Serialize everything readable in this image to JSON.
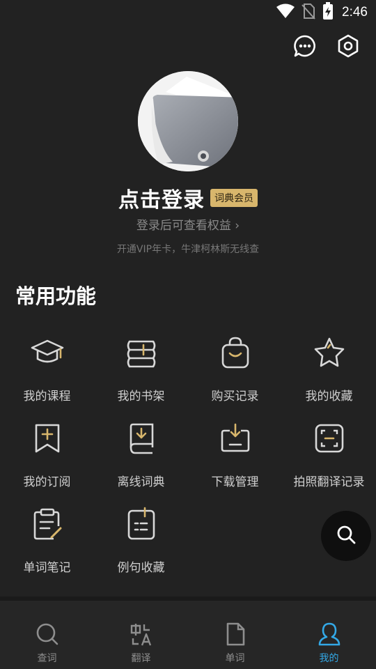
{
  "status_bar": {
    "time": "2:46"
  },
  "profile": {
    "login_title": "点击登录",
    "vip_badge": "词典会员",
    "login_subtitle": "登录后可查看权益 ›",
    "login_note": "开通VIP年卡，牛津柯林斯无线查"
  },
  "section": {
    "title": "常用功能"
  },
  "features": [
    {
      "label": "我的课程",
      "icon": "graduation-cap-icon"
    },
    {
      "label": "我的书架",
      "icon": "bookshelf-icon"
    },
    {
      "label": "购买记录",
      "icon": "shopping-bag-icon"
    },
    {
      "label": "我的收藏",
      "icon": "star-icon"
    },
    {
      "label": "我的订阅",
      "icon": "bookmark-plus-icon"
    },
    {
      "label": "离线词典",
      "icon": "offline-book-icon"
    },
    {
      "label": "下载管理",
      "icon": "download-tray-icon"
    },
    {
      "label": "拍照翻译记录",
      "icon": "scan-icon"
    },
    {
      "label": "单词笔记",
      "icon": "clipboard-pen-icon"
    },
    {
      "label": "例句收藏",
      "icon": "sentence-list-icon"
    }
  ],
  "bottom_nav": [
    {
      "label": "查词",
      "icon": "search-icon",
      "active": false
    },
    {
      "label": "翻译",
      "icon": "translate-icon",
      "active": false
    },
    {
      "label": "单词",
      "icon": "document-icon",
      "active": false
    },
    {
      "label": "我的",
      "icon": "person-icon",
      "active": true
    }
  ],
  "colors": {
    "background": "#222222",
    "accent": "#33a8e6",
    "gold": "#d8b66c",
    "badge": "#d8b66c"
  }
}
